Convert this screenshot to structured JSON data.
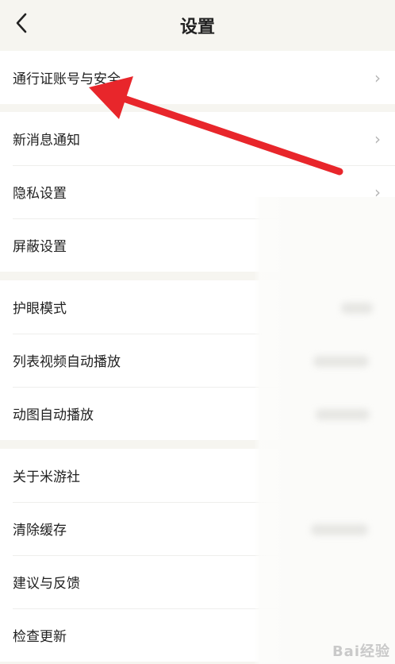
{
  "header": {
    "title": "设置",
    "back_icon": "‹"
  },
  "groups": [
    {
      "items": [
        {
          "label": "通行证账号与安全"
        }
      ]
    },
    {
      "items": [
        {
          "label": "新消息通知"
        },
        {
          "label": "隐私设置"
        },
        {
          "label": "屏蔽设置"
        }
      ]
    },
    {
      "items": [
        {
          "label": "护眼模式"
        },
        {
          "label": "列表视频自动播放"
        },
        {
          "label": "动图自动播放"
        }
      ]
    },
    {
      "items": [
        {
          "label": "关于米游社"
        },
        {
          "label": "清除缓存"
        },
        {
          "label": "建议与反馈"
        },
        {
          "label": "检查更新"
        }
      ]
    }
  ],
  "chevron": "›",
  "annotation_color": "#e8262b",
  "watermark": "Bai经验"
}
